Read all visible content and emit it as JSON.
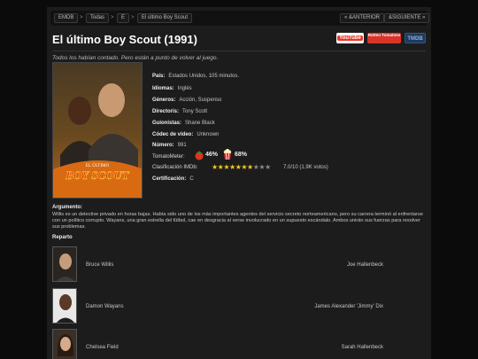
{
  "breadcrumb": {
    "items": [
      "EMDB",
      "Todas",
      "E",
      "El último Boy Scout"
    ],
    "separator": ">"
  },
  "pager": {
    "prev_label": "« &ANTERIOR",
    "next_label": "&SIGUIENTE »"
  },
  "movie": {
    "title": "El último Boy Scout (1991)",
    "tagline": "Todos los habían contado. Pero están a punto de volver al juego.",
    "poster_text_top": "EL ÚLTIMO",
    "poster_text_main": "BOY SCOUT"
  },
  "logos": {
    "youtube": "YouTube",
    "rottentomatoes": "Rotten Tomatoes",
    "tmdb": "TMDB"
  },
  "details": [
    {
      "label": "País:",
      "value": "Estados Unidos, 105 minutos."
    },
    {
      "label": "Idiomas:",
      "value": "Inglés"
    },
    {
      "label": "Géneros:",
      "value": "Acción, Suspenso"
    },
    {
      "label": "Directoris:",
      "value": "Tony Scott"
    },
    {
      "label": "Guionistas:",
      "value": "Shane Black"
    },
    {
      "label": "Códec de vídeo:",
      "value": "Unknown"
    },
    {
      "label": "Número:",
      "value": "991"
    }
  ],
  "tomatometer": {
    "label": "TomatoMeter:",
    "critics": "46%",
    "audience": "68%"
  },
  "imdb": {
    "label": "Clasificación IMDb:",
    "rating": 7.0,
    "stars_total": 10,
    "text": "7.0/10 (1.9K votos)"
  },
  "certification": {
    "label": "Certificación:",
    "value": "C"
  },
  "plot": {
    "label": "Argumento:",
    "text": "Willis es un detective privado en horas bajas. Había sido uno de los más importantes agentes del servicio secreto norteamericano, pero su carrera terminó al enfrentarse con un político corrupto. Wayans, una gran estrella del fútbol, cae en desgracia al verse involucrado en un supuesto escándalo. Ambos unirán sus fuerzas para resolver sus problemas."
  },
  "cast": {
    "label": "Reparto",
    "members": [
      {
        "actor": "Bruce Willis",
        "role": "Joe Hallenbeck"
      },
      {
        "actor": "Damon Wayans",
        "role": "James Alexander 'Jimmy' Dix"
      },
      {
        "actor": "Chelsea Field",
        "role": "Sarah Hallenbeck"
      }
    ]
  },
  "colors": {
    "background": "#0b0b0b",
    "panel": "#1c1c1c",
    "star_on": "#f3c623",
    "star_off": "#8a8a8a"
  }
}
